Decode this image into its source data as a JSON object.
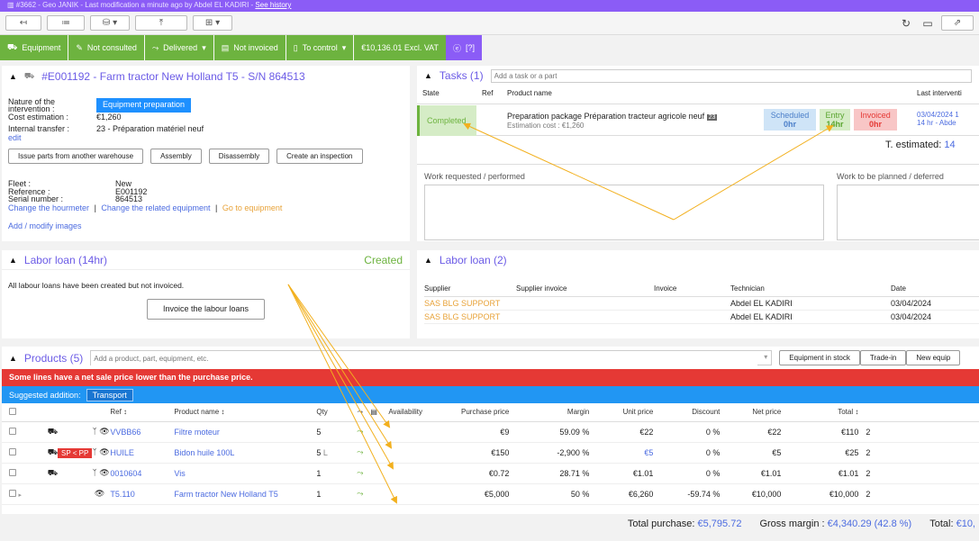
{
  "topbar": {
    "text": "#3662  -  Geo JANIK  -  Last modification a minute ago by Abdel EL KADIRI  -  ",
    "link": "See history"
  },
  "status": {
    "equipment": "Equipment",
    "consulted": "Not consulted",
    "delivered": "Delivered",
    "invoiced": "Not invoiced",
    "control": "To control",
    "amount": "€10,136.01 Excl. VAT",
    "extra": "[?]"
  },
  "equipment_panel": {
    "title": "#E001192 - Farm tractor New Holland T5 - S/N 864513",
    "nature_label": "Nature of the intervention :",
    "nature_value": "Equipment preparation",
    "cost_label": "Cost estimation :",
    "cost_value": "€1,260",
    "transfer_label": "Internal transfer :",
    "transfer_value": "23 - Préparation matériel neuf",
    "edit": "edit",
    "buttons": [
      "Issue parts from another warehouse",
      "Assembly",
      "Disassembly",
      "Create an inspection"
    ],
    "fleet_label": "Fleet :",
    "fleet_value": "New",
    "ref_label": "Reference :",
    "ref_value": "E001192",
    "serial_label": "Serial number :",
    "serial_value": "864513",
    "change_hourmeter": "Change the hourmeter",
    "change_related": "Change the related equipment",
    "go_equipment": "Go to equipment",
    "add_images": "Add / modify images"
  },
  "tasks": {
    "title": "Tasks (1)",
    "placeholder": "Add a task or a part",
    "headers": {
      "state": "State",
      "ref": "Ref",
      "product": "Product name",
      "last": "Last interventi"
    },
    "row": {
      "state": "Completed",
      "product": "Preparation package Préparation tracteur agricole neuf",
      "badge": "23",
      "estimation": "Estimation cost : €1,260",
      "scheduled": "Scheduled",
      "scheduled_v": "0hr",
      "entry": "Entry",
      "entry_v": "14hr",
      "invoiced": "Invoiced",
      "invoiced_v": "0hr",
      "last_date": "03/04/2024 1",
      "last_who": "14 hr - Abde"
    },
    "t_estimated_label": "T. estimated:",
    "t_estimated_value": "14",
    "work_requested": "Work requested / performed",
    "work_planned": "Work to be planned / deferred"
  },
  "labor_left": {
    "title": "Labor loan (14hr)",
    "status": "Created",
    "message": "All labour loans have been created but not invoiced.",
    "button": "Invoice the labour loans"
  },
  "labor_right": {
    "title": "Labor loan (2)",
    "headers": [
      "Supplier",
      "Supplier invoice",
      "Invoice",
      "Technician",
      "Date"
    ],
    "rows": [
      [
        "SAS BLG SUPPORT",
        "",
        "",
        "Abdel EL KADIRI",
        "03/04/2024"
      ],
      [
        "SAS BLG SUPPORT",
        "",
        "",
        "Abdel EL KADIRI",
        "03/04/2024"
      ]
    ]
  },
  "products": {
    "title": "Products (5)",
    "placeholder": "Add a product, part, equipment, etc.",
    "btn_stock": "Equipment in stock",
    "btn_trade": "Trade-in",
    "btn_new": "New equip",
    "warning": "Some lines have a net sale price lower than the purchase price.",
    "suggested_label": "Suggested addition:",
    "suggested_btn": "Transport",
    "headers": {
      "ref": "Ref ↕",
      "name": "Product name ↕",
      "qty": "Qty",
      "availability": "Availability",
      "purchase": "Purchase price",
      "margin": "Margin",
      "unit": "Unit price",
      "discount": "Discount",
      "net": "Net price",
      "total": "Total ↕"
    },
    "rows": [
      {
        "ref": "VVBB66",
        "name": "Filtre moteur",
        "qty": "5",
        "qtyu": "",
        "purchase": "€9",
        "margin": "59.09 %",
        "unit": "€22",
        "discount": "0 %",
        "net": "€22",
        "total": "€110",
        "tail": "2",
        "sp": ""
      },
      {
        "ref": "HUILE",
        "name": "Bidon huile 100L",
        "qty": "5",
        "qtyu": "L",
        "purchase": "€150",
        "margin": "-2,900 %",
        "unit": "€5",
        "discount": "0 %",
        "net": "€5",
        "total": "€25",
        "tail": "2",
        "sp": "SP < PP"
      },
      {
        "ref": "0010604",
        "name": "Vis",
        "qty": "1",
        "qtyu": "",
        "purchase": "€0.72",
        "margin": "28.71 %",
        "unit": "€1.01",
        "discount": "0 %",
        "net": "€1.01",
        "total": "€1.01",
        "tail": "2",
        "sp": ""
      },
      {
        "ref": "T5.110",
        "name": "Farm tractor New Holland T5",
        "qty": "1",
        "qtyu": "",
        "purchase": "€5,000",
        "margin": "50 %",
        "unit": "€6,260",
        "discount": "-59.74 %",
        "net": "€10,000",
        "total": "€10,000",
        "tail": "2",
        "sp": ""
      }
    ],
    "total_purchase_label": "Total purchase:",
    "total_purchase_value": "€5,795.72",
    "gross_margin_label": "Gross margin :",
    "gross_margin_value": "€4,340.29 (42.8 %)",
    "total_label": "Total:",
    "total_value": "€10,"
  },
  "colors": {
    "accent": "#8b5cf6",
    "green": "#6db33f",
    "link": "#4b6be0",
    "orange": "#e8a33a",
    "red": "#e53935",
    "blue": "#2196f3"
  }
}
